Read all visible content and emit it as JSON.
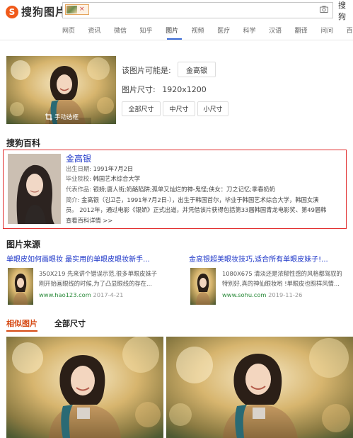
{
  "header": {
    "logo_text": "搜狗图片",
    "logo_letter": "S",
    "chip_close": "×",
    "search_button": "搜狗"
  },
  "nav": [
    "网页",
    "资讯",
    "微信",
    "知乎",
    "图片",
    "视频",
    "医疗",
    "科学",
    "汉语",
    "翻译",
    "问问",
    "百"
  ],
  "result": {
    "possible_label": "该图片可能是:",
    "possible_name": "金高银",
    "size_label": "图片尺寸:",
    "size_value": "1920x1200",
    "crop_label": "手动选框",
    "buttons": [
      "全部尺寸",
      "中尺寸",
      "小尺寸"
    ]
  },
  "baike": {
    "section_title": "搜狗百科",
    "name": "金高银",
    "rows": [
      {
        "k": "出生日期:",
        "v": "1991年7月2日"
      },
      {
        "k": "毕业院校:",
        "v": "韩国艺术综合大学"
      },
      {
        "k": "代表作品:",
        "v": "银娇;唐人街;奶酪陷阱;孤单又灿烂的神-鬼怪;侠女：刀之记忆;季春奶奶"
      },
      {
        "k": "简介:",
        "v": "金高银（김고은，1991年7月2日-），出生于韩国首尔，毕业于韩国艺术综合大学，韩国女演"
      },
      {
        "k": "",
        "v": "员。 2012年，通过电影《银娇》正式出道，并凭借该片获得包括第33届韩国青龙电影奖、第49届韩"
      }
    ],
    "more": "查看百科详情 >>"
  },
  "sources": {
    "section_title": "图片来源",
    "items": [
      {
        "title": "单眼皮如何画眼妆 最实用的单眼皮眼妆新手...",
        "desc1": "350X219 先来讲个错误示范,很多单眼皮妹子",
        "desc2": "刚开始画眼线的时候,为了凸显眼线的存在...",
        "domain": "www.hao123.com",
        "date": "2017-4-21"
      },
      {
        "title": "金高银超美眼妆技巧,适合所有单眼皮妹子!...",
        "desc1": "1080X675 清淡还是浓郁性感的风格都驾驭的",
        "desc2": "特别好,真的神仙眼妆哟 !单眼皮也照样风情...",
        "domain": "www.sohu.com",
        "date": "2019-11-26"
      }
    ]
  },
  "tabs": {
    "similar": "相似图片",
    "all_sizes": "全部尺寸"
  },
  "colors": {
    "accent": "#d64a14",
    "link": "#1a33c7",
    "highlight_border": "#e12d2d",
    "logo": "#f05a1a"
  }
}
